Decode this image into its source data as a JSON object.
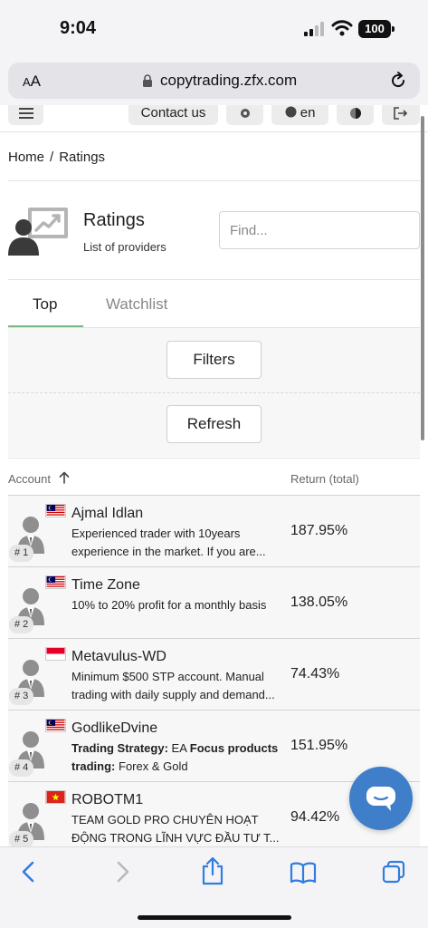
{
  "status": {
    "time": "9:04",
    "battery": "100"
  },
  "browser": {
    "aa_small": "A",
    "aa_large": "A",
    "url": "copytrading.zfx.com"
  },
  "header": {
    "contact_label": "Contact us",
    "lang_label": "en"
  },
  "breadcrumb": {
    "home": "Home",
    "separator": "/",
    "current": "Ratings"
  },
  "page": {
    "title": "Ratings",
    "subtitle": "List of providers"
  },
  "search": {
    "placeholder": "Find..."
  },
  "tabs": [
    {
      "label": "Top",
      "active": true
    },
    {
      "label": "Watchlist",
      "active": false
    }
  ],
  "buttons": {
    "filters": "Filters",
    "refresh": "Refresh"
  },
  "table": {
    "columns": {
      "account": "Account",
      "return": "Return (total)"
    },
    "rows": [
      {
        "rank": "# 1",
        "flag": "malaysia",
        "name": "Ajmal Idlan",
        "desc": "Experienced trader with 10years experience in the market. If you are...",
        "return": "187.95%"
      },
      {
        "rank": "# 2",
        "flag": "malaysia",
        "name": "Time Zone",
        "desc": "10% to 20% profit for a monthly basis",
        "return": "138.05%"
      },
      {
        "rank": "# 3",
        "flag": "indonesia",
        "name": "Metavulus-WD",
        "desc": "Minimum $500 STP account. Manual trading with daily supply and demand...",
        "return": "74.43%"
      },
      {
        "rank": "# 4",
        "flag": "malaysia",
        "name": "GodlikeDvine",
        "desc_parts": {
          "b1": "Trading Strategy:",
          "t1": " EA ",
          "b2": "Focus products trading:",
          "t2": " Forex & Gold"
        },
        "return": "151.95%"
      },
      {
        "rank": "# 5",
        "flag": "vietnam",
        "name": "ROBOTM1",
        "desc": "TEAM GOLD PRO CHUYÊN HOẠT ĐỘNG TRONG LĨNH VỰC ĐẦU TƯ T...",
        "return": "94.42%"
      }
    ]
  },
  "colors": {
    "accent_tab": "#79b987",
    "chat_button": "#3f7fc9",
    "ios_blue": "#2f7de1"
  }
}
